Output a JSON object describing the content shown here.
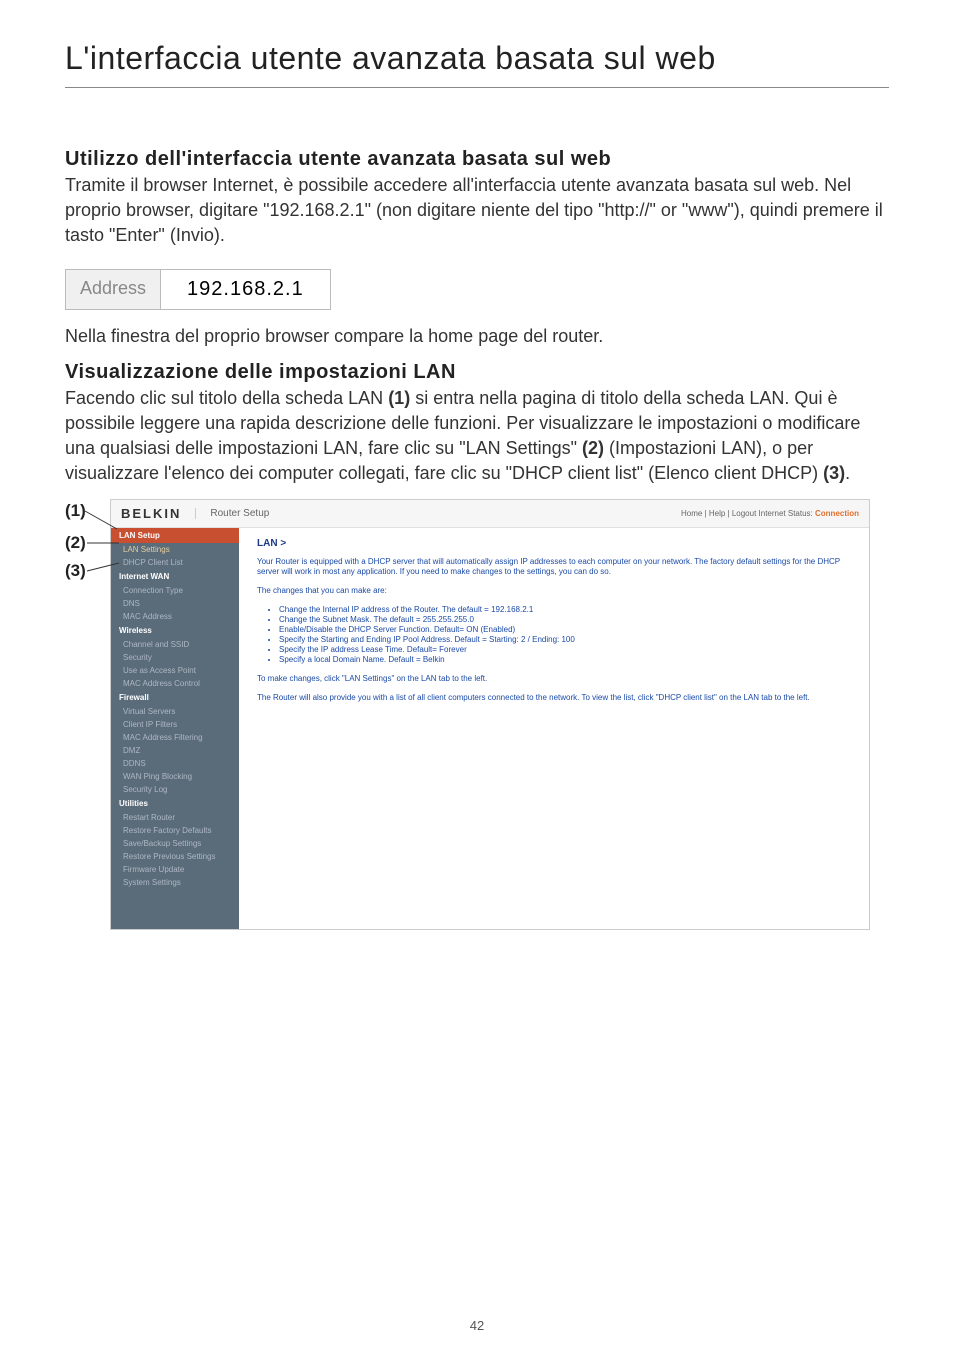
{
  "page": {
    "title": "L'interfaccia utente avanzata basata sul web",
    "number": "42"
  },
  "section1": {
    "heading": "Utilizzo dell'interfaccia utente avanzata basata sul web",
    "body": "Tramite il browser Internet, è possibile accedere all'interfaccia utente avanzata basata sul web. Nel proprio browser, digitare \"192.168.2.1\" (non digitare niente del tipo \"http://\" or \"www\"), quindi premere il tasto \"Enter\" (Invio)."
  },
  "address_box": {
    "label": "Address",
    "value": "192.168.2.1"
  },
  "after_address": "Nella finestra del proprio browser compare la home page del router.",
  "section2": {
    "heading": "Visualizzazione delle impostazioni LAN",
    "body_parts": {
      "p1a": "Facendo clic sul titolo della scheda LAN ",
      "b1": "(1)",
      "p1b": " si entra nella pagina di titolo della scheda LAN. Qui è possibile leggere una rapida descrizione delle funzioni. Per visualizzare le impostazioni o modificare una qualsiasi delle impostazioni LAN, fare clic su \"LAN Settings\" ",
      "b2": "(2)",
      "p1c": " (Impostazioni LAN), o per visualizzare l'elenco dei computer collegati, fare clic su \"DHCP client list\" (Elenco client DHCP) ",
      "b3": "(3)",
      "p1d": "."
    }
  },
  "callouts": {
    "c1": "(1)",
    "c2": "(2)",
    "c3": "(3)"
  },
  "router": {
    "brand": "BELKIN",
    "subtitle": "Router Setup",
    "top_right_links": "Home | Help | Logout   Internet Status: ",
    "top_right_status": "Connection",
    "sidebar": {
      "g_lan": "LAN Setup",
      "lan_settings": "LAN Settings",
      "dhcp_list": "DHCP Client List",
      "g_wan": "Internet WAN",
      "conn_type": "Connection Type",
      "dns": "DNS",
      "mac": "MAC Address",
      "g_wl": "Wireless",
      "chan": "Channel and SSID",
      "sec": "Security",
      "ap": "Use as Access Point",
      "macctl": "MAC Address Control",
      "g_fw": "Firewall",
      "vs": "Virtual Servers",
      "cip": "Client IP Filters",
      "macf": "MAC Address Filtering",
      "dmz": "DMZ",
      "ddns": "DDNS",
      "wpb": "WAN Ping Blocking",
      "slog": "Security Log",
      "g_ut": "Utilities",
      "rr": "Restart Router",
      "rfd": "Restore Factory Defaults",
      "sbs": "Save/Backup Settings",
      "rps": "Restore Previous Settings",
      "fwu": "Firmware Update",
      "sys": "System Settings"
    },
    "content": {
      "crumb": "LAN >",
      "p1": "Your Router is equipped with a DHCP server that will automatically assign IP addresses to each computer on your network. The factory default settings for the DHCP server will work in most any application. If you need to make changes to the settings, you can do so.",
      "p2": "The changes that you can make are:",
      "li1": "Change the Internal IP address of the Router. The default = 192.168.2.1",
      "li2": "Change the Subnet Mask. The default = 255.255.255.0",
      "li3": "Enable/Disable the DHCP Server Function. Default= ON (Enabled)",
      "li4": "Specify the Starting and Ending IP Pool Address. Default = Starting: 2 / Ending: 100",
      "li5": "Specify the IP address Lease Time. Default= Forever",
      "li6": "Specify a local Domain Name. Default = Belkin",
      "p3": "To make changes, click \"LAN Settings\" on the LAN tab to the left.",
      "p4": "The Router will also provide you with a list of all client computers connected to the network. To view the list, click \"DHCP client list\" on the LAN tab to the left."
    }
  }
}
